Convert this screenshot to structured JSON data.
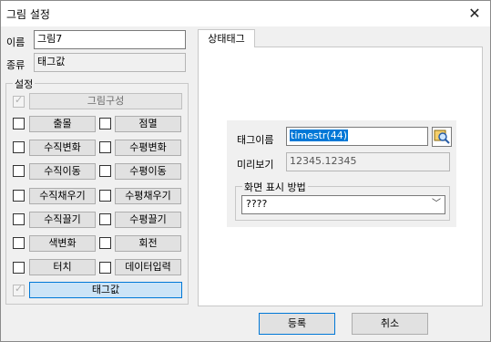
{
  "window": {
    "title": "그림 설정"
  },
  "name": {
    "label": "이름",
    "value": "그림7"
  },
  "type": {
    "label": "종류",
    "value": "태그값"
  },
  "settings": {
    "group_title": "설정",
    "rows": [
      {
        "left": "그림구성"
      },
      {
        "left": "출몰",
        "right": "점멸"
      },
      {
        "left": "수직변화",
        "right": "수평변화"
      },
      {
        "left": "수직이동",
        "right": "수평이동"
      },
      {
        "left": "수직채우기",
        "right": "수평채우기"
      },
      {
        "left": "수직끌기",
        "right": "수평끌기"
      },
      {
        "left": "색변화",
        "right": "회전"
      },
      {
        "left": "터치",
        "right": "데이터입력"
      },
      {
        "left": "태그값"
      }
    ]
  },
  "tabs": [
    {
      "label": "상태태그"
    }
  ],
  "tag": {
    "name_label": "태그이름",
    "name_value": "timestr(44)",
    "preview_label": "미리보기",
    "preview_value": "12345.12345",
    "display_group_title": "화면 표시 방법",
    "display_value": "????"
  },
  "buttons": {
    "ok": "등록",
    "cancel": "취소"
  }
}
